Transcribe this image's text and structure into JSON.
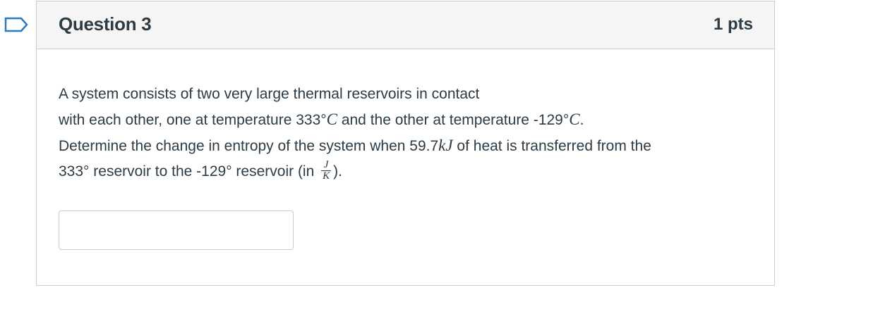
{
  "question": {
    "title": "Question 3",
    "points": "1 pts",
    "text": {
      "line1": "A system consists of two very large thermal reservoirs in contact",
      "line2_a": "with each other, one at temperature 333°",
      "line2_c1": "C",
      "line2_b": " and the other at temperature  -129°",
      "line2_c2": "C",
      "line2_end": ".",
      "line3_a": "Determine the change in entropy of the system when 59.7",
      "line3_kj": "kJ",
      "line3_b": " of heat is transferred from the",
      "line4_a": "333° reservoir to the  -129° reservoir (in ",
      "frac_num": "J",
      "frac_den": "K",
      "line4_end": ")."
    },
    "answer": {
      "value": "",
      "placeholder": ""
    }
  },
  "colors": {
    "flag": "#2b7abc",
    "border": "#c7cdd1",
    "header_bg": "#f5f5f5",
    "text": "#2d3b45"
  },
  "icons": {
    "flag": "flag-outline-icon"
  }
}
